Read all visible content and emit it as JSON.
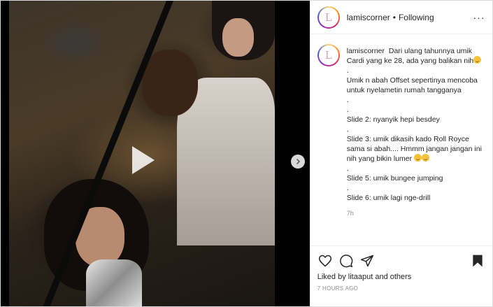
{
  "header": {
    "avatar_letter": "L",
    "username": "lamiscorner",
    "separator": "•",
    "follow_state": "Following",
    "more_label": "···"
  },
  "caption": {
    "username": "lamiscorner",
    "lines": [
      "Dari ulang tahunnya umik Cardi yang ke 28, ada yang balikan nih",
      ".",
      "Umik n abah Offset sepertinya mencoba untuk nyelametin rumah tangganya",
      ".",
      ".",
      "Slide 2: nyanyik hepi besdey",
      ".",
      "Slide 3: umik dikasih kado Roll Royce sama si abah.... Hmmm jangan jangan ini nih yang bikin lumer",
      ".",
      "Slide 5: umik bungee jumping",
      ".",
      "Slide 6: umik lagi nge-drill"
    ],
    "time": "7h"
  },
  "actions": {
    "icons": [
      "heart-icon",
      "comment-icon",
      "share-icon",
      "bookmark-icon"
    ],
    "liked_prefix": "Liked by",
    "liked_user": "litaaput",
    "liked_suffix": "and others",
    "post_time": "7 HOURS AGO"
  },
  "media": {
    "play_icon": "play-icon",
    "next_icon": "chevron-right-icon"
  }
}
